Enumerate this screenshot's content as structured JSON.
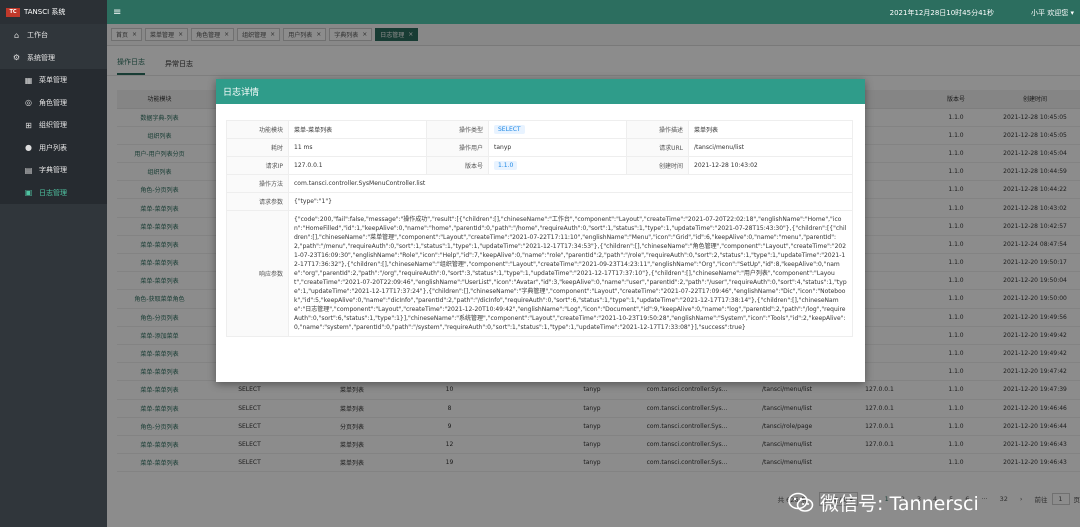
{
  "brand": {
    "logo": "TC",
    "title": "TANSCI 系统"
  },
  "sidebar": {
    "items": [
      {
        "label": "工作台",
        "icon": "home-icon",
        "glyph": "⌂",
        "sub": false,
        "active": false
      },
      {
        "label": "系统管理",
        "icon": "gear-icon",
        "glyph": "⚙",
        "sub": false,
        "active": false
      },
      {
        "label": "菜单管理",
        "icon": "grid-icon",
        "glyph": "▦",
        "sub": true,
        "active": false
      },
      {
        "label": "角色管理",
        "icon": "globe-icon",
        "glyph": "◎",
        "sub": true,
        "active": false
      },
      {
        "label": "组织管理",
        "icon": "org-icon",
        "glyph": "⊞",
        "sub": true,
        "active": false
      },
      {
        "label": "用户列表",
        "icon": "user-icon",
        "glyph": "●",
        "sub": true,
        "active": false
      },
      {
        "label": "字典管理",
        "icon": "book-icon",
        "glyph": "▤",
        "sub": true,
        "active": false
      },
      {
        "label": "日志管理",
        "icon": "log-icon",
        "glyph": "▣",
        "sub": true,
        "active": true
      }
    ]
  },
  "topbar": {
    "datetime": "2021年12月28日10时45分41秒",
    "user": "小平 欢迎您 ▾"
  },
  "tabs": [
    {
      "label": "首页",
      "active": false
    },
    {
      "label": "菜单管理",
      "active": false
    },
    {
      "label": "角色管理",
      "active": false
    },
    {
      "label": "组织管理",
      "active": false
    },
    {
      "label": "用户列表",
      "active": false
    },
    {
      "label": "字典列表",
      "active": false
    },
    {
      "label": "日志管理",
      "active": true
    }
  ],
  "subtabs": [
    {
      "label": "操作日志",
      "active": true
    },
    {
      "label": "异常日志",
      "active": false
    }
  ],
  "table": {
    "headers": [
      "功能模块",
      "",
      "",
      "",
      "",
      "",
      "",
      "",
      "",
      "版本号",
      "创建时间"
    ],
    "rows": [
      [
        "数据字典-列表",
        "",
        "",
        "",
        "",
        "",
        "",
        "",
        "",
        "1.1.0",
        "2021-12-28 10:45:05"
      ],
      [
        "组织列表",
        "",
        "",
        "",
        "",
        "",
        "",
        "",
        "",
        "1.1.0",
        "2021-12-28 10:45:05"
      ],
      [
        "用户-用户列表分页",
        "",
        "",
        "",
        "",
        "",
        "",
        "",
        "",
        "1.1.0",
        "2021-12-28 10:45:04"
      ],
      [
        "组织列表",
        "",
        "",
        "",
        "",
        "",
        "",
        "",
        "",
        "1.1.0",
        "2021-12-28 10:44:59"
      ],
      [
        "角色-分页列表",
        "",
        "",
        "",
        "",
        "",
        "",
        "",
        "",
        "1.1.0",
        "2021-12-28 10:44:22"
      ],
      [
        "菜单-菜单列表",
        "",
        "",
        "",
        "",
        "",
        "",
        "",
        "",
        "1.1.0",
        "2021-12-28 10:43:02"
      ],
      [
        "菜单-菜单列表",
        "",
        "",
        "",
        "",
        "",
        "",
        "",
        "",
        "1.1.0",
        "2021-12-28 10:42:57"
      ],
      [
        "菜单-菜单列表",
        "",
        "",
        "",
        "",
        "",
        "",
        "",
        "",
        "1.1.0",
        "2021-12-24 08:47:54"
      ],
      [
        "菜单-菜单列表",
        "",
        "",
        "",
        "",
        "",
        "",
        "",
        "",
        "1.1.0",
        "2021-12-20 19:50:17"
      ],
      [
        "菜单-菜单列表",
        "",
        "",
        "",
        "",
        "",
        "",
        "",
        "",
        "1.1.0",
        "2021-12-20 19:50:04"
      ],
      [
        "角色-获取菜单角色",
        "",
        "",
        "",
        "",
        "",
        "",
        "",
        "",
        "1.1.0",
        "2021-12-20 19:50:00"
      ],
      [
        "角色-分页列表",
        "",
        "",
        "",
        "",
        "",
        "",
        "",
        "",
        "1.1.0",
        "2021-12-20 19:49:56"
      ],
      [
        "菜单-添加菜单",
        "",
        "",
        "",
        "",
        "",
        "",
        "",
        "",
        "1.1.0",
        "2021-12-20 19:49:42"
      ],
      [
        "菜单-菜单列表",
        "",
        "",
        "",
        "",
        "",
        "",
        "",
        "",
        "1.1.0",
        "2021-12-20 19:49:42"
      ],
      [
        "菜单-菜单列表",
        "",
        "",
        "",
        "",
        "",
        "",
        "",
        "",
        "1.1.0",
        "2021-12-20 19:47:42"
      ],
      [
        "菜单-菜单列表",
        "SELECT",
        "菜单列表",
        "10",
        "",
        "tanyp",
        "com.tansci.controller.Sys...",
        "/tansci/menu/list",
        "127.0.0.1",
        "1.1.0",
        "2021-12-20 19:47:39"
      ],
      [
        "菜单-菜单列表",
        "SELECT",
        "菜单列表",
        "8",
        "",
        "tanyp",
        "com.tansci.controller.Sys...",
        "/tansci/menu/list",
        "127.0.0.1",
        "1.1.0",
        "2021-12-20 19:46:46"
      ],
      [
        "角色-分页列表",
        "SELECT",
        "分页列表",
        "9",
        "",
        "tanyp",
        "com.tansci.controller.Sys...",
        "/tansci/role/page",
        "127.0.0.1",
        "1.1.0",
        "2021-12-20 19:46:44"
      ],
      [
        "菜单-菜单列表",
        "SELECT",
        "菜单列表",
        "12",
        "",
        "tanyp",
        "com.tansci.controller.Sys...",
        "/tansci/menu/list",
        "127.0.0.1",
        "1.1.0",
        "2021-12-20 19:46:43"
      ],
      [
        "菜单-菜单列表",
        "SELECT",
        "菜单列表",
        "19",
        "",
        "tanyp",
        "com.tansci.controller.Sys...",
        "/tansci/menu/list",
        "",
        "1.1.0",
        "2021-12-20 19:46:43"
      ]
    ]
  },
  "pager": {
    "total": "共 626 条",
    "size": "20条/页",
    "prev": "‹",
    "pages": [
      "1",
      "2",
      "3",
      "4",
      "5",
      "6"
    ],
    "ellipsis": "···",
    "last": "32",
    "next": "›",
    "goto_label": "前往",
    "page": "1",
    "unit": "页"
  },
  "modal": {
    "title": "日志详情",
    "labels": {
      "module": "功能模块",
      "op_type": "操作类型",
      "op_desc": "操作描述",
      "elapsed": "耗时",
      "op_user": "操作用户",
      "url": "请求URL",
      "ip": "请求IP",
      "version": "版本号",
      "created": "创建时间",
      "method": "操作方法",
      "params": "请求参数",
      "response": "响应参数"
    },
    "values": {
      "module": "菜单-菜单列表",
      "op_type": "SELECT",
      "op_desc": "菜单列表",
      "elapsed": "11 ms",
      "op_user": "tanyp",
      "url": "/tansci/menu/list",
      "ip": "127.0.0.1",
      "version": "1.1.0",
      "created": "2021-12-28 10:43:02",
      "method": "com.tansci.controller.SysMenuController.list",
      "params": "{\"type\":\"1\"}",
      "response": "{\"code\":200,\"fail\":false,\"message\":\"操作成功\",\"result\":[{\"children\":[],\"chineseName\":\"工作台\",\"component\":\"Layout\",\"createTime\":\"2021-07-20T22:02:18\",\"englishName\":\"Home\",\"icon\":\"HomeFilled\",\"id\":1,\"keepAlive\":0,\"name\":\"home\",\"parentId\":0,\"path\":\"/home\",\"requireAuth\":0,\"sort\":1,\"status\":1,\"type\":1,\"updateTime\":\"2021-07-28T15:43:30\"},{\"children\":[{\"children\":[],\"chineseName\":\"菜单管理\",\"component\":\"Layout\",\"createTime\":\"2021-07-22T17:11:10\",\"englishName\":\"Menu\",\"icon\":\"Grid\",\"id\":6,\"keepAlive\":0,\"name\":\"menu\",\"parentId\":2,\"path\":\"/menu\",\"requireAuth\":0,\"sort\":1,\"status\":1,\"type\":1,\"updateTime\":\"2021-12-17T17:34:53\"},{\"children\":[],\"chineseName\":\"角色管理\",\"component\":\"Layout\",\"createTime\":\"2021-07-23T16:09:30\",\"englishName\":\"Role\",\"icon\":\"Help\",\"id\":7,\"keepAlive\":0,\"name\":\"role\",\"parentId\":2,\"path\":\"/role\",\"requireAuth\":0,\"sort\":2,\"status\":1,\"type\":1,\"updateTime\":\"2021-12-17T17:36:32\"},{\"children\":[],\"chineseName\":\"组织管理\",\"component\":\"Layout\",\"createTime\":\"2021-09-23T14:23:11\",\"englishName\":\"Org\",\"icon\":\"SetUp\",\"id\":8,\"keepAlive\":0,\"name\":\"org\",\"parentId\":2,\"path\":\"/org\",\"requireAuth\":0,\"sort\":3,\"status\":1,\"type\":1,\"updateTime\":\"2021-12-17T17:37:10\"},{\"children\":[],\"chineseName\":\"用户列表\",\"component\":\"Layout\",\"createTime\":\"2021-07-20T22:09:46\",\"englishName\":\"UserList\",\"icon\":\"Avatar\",\"id\":3,\"keepAlive\":0,\"name\":\"user\",\"parentId\":2,\"path\":\"/user\",\"requireAuth\":0,\"sort\":4,\"status\":1,\"type\":1,\"updateTime\":\"2021-12-17T17:37:24\"},{\"children\":[],\"chineseName\":\"字典管理\",\"component\":\"Layout\",\"createTime\":\"2021-07-22T17:09:46\",\"englishName\":\"Dic\",\"icon\":\"Notebook\",\"id\":5,\"keepAlive\":0,\"name\":\"dicInfo\",\"parentId\":2,\"path\":\"/dicInfo\",\"requireAuth\":0,\"sort\":6,\"status\":1,\"type\":1,\"updateTime\":\"2021-12-17T17:38:14\"},{\"children\":[],\"chineseName\":\"日志管理\",\"component\":\"Layout\",\"createTime\":\"2021-12-20T10:49:42\",\"englishName\":\"Log\",\"icon\":\"Document\",\"id\":9,\"keepAlive\":0,\"name\":\"log\",\"parentId\":2,\"path\":\"/log\",\"requireAuth\":0,\"sort\":6,\"status\":1,\"type\":1}],\"chineseName\":\"系统管理\",\"component\":\"Layout\",\"createTime\":\"2021-10-23T19:50:28\",\"englishName\":\"System\",\"icon\":\"Tools\",\"id\":2,\"keepAlive\":0,\"name\":\"system\",\"parentId\":0,\"path\":\"/system\",\"requireAuth\":0,\"sort\":1,\"status\":1,\"type\":1,\"updateTime\":\"2021-12-17T17:33:08\"}],\"success\":true}"
    }
  },
  "watermark": {
    "text": "微信号: Tannersci",
    "icon": "wechat-icon"
  },
  "colors": {
    "sidebar": "#30363b",
    "header": "#2c6e5f",
    "modal_header": "#2f9c8a",
    "accent": "#2c6e5f",
    "tag_bg": "#e8f3ff",
    "tag_fg": "#1e88e5"
  }
}
